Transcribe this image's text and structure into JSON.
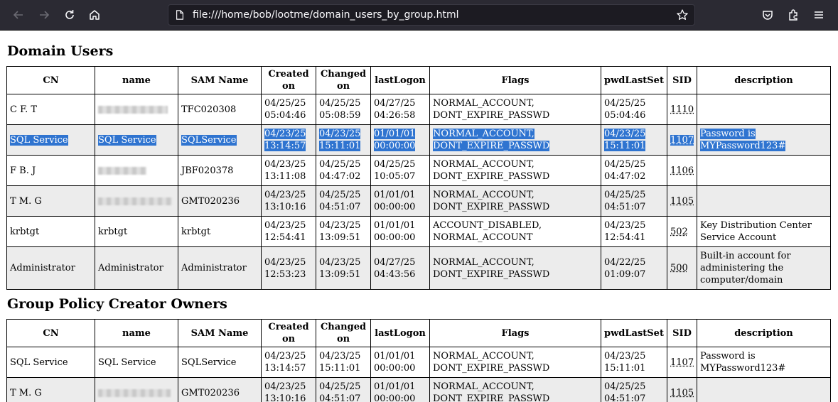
{
  "browser": {
    "url": "file:///home/bob/lootme/domain_users_by_group.html",
    "icons": [
      "back-icon",
      "forward-icon",
      "reload-icon",
      "home-icon",
      "page-icon",
      "bookmark-star-icon",
      "pocket-icon",
      "extensions-icon",
      "menu-icon"
    ]
  },
  "columns": [
    "CN",
    "name",
    "SAM Name",
    "Created on",
    "Changed on",
    "lastLogon",
    "Flags",
    "pwdLastSet",
    "SID",
    "description"
  ],
  "sections": [
    {
      "title": "Domain Users",
      "rows": [
        {
          "cn": "C F. T",
          "name": "",
          "sam": "TFC020308",
          "created": "04/25/25 05:04:46",
          "changed": "04/25/25 05:08:59",
          "lastlogon": "04/27/25 04:26:58",
          "flags": "NORMAL_ACCOUNT, DONT_EXPIRE_PASSWD",
          "pwdlastset": "04/25/25 05:04:46",
          "sid": "1110",
          "description": ""
        },
        {
          "cn": "SQL Service",
          "name": "SQL Service",
          "sam": "SQLService",
          "created": "04/23/25 13:14:57",
          "changed": "04/23/25 15:11:01",
          "lastlogon": "01/01/01 00:00:00",
          "flags": "NORMAL_ACCOUNT, DONT_EXPIRE_PASSWD",
          "pwdlastset": "04/23/25 15:11:01",
          "sid": "1107",
          "description": "Password is MYPassword123#"
        },
        {
          "cn": "F B. J",
          "name": "",
          "sam": "JBF020378",
          "created": "04/23/25 13:11:08",
          "changed": "04/25/25 04:47:02",
          "lastlogon": "04/25/25 10:05:07",
          "flags": "NORMAL_ACCOUNT, DONT_EXPIRE_PASSWD",
          "pwdlastset": "04/25/25 04:47:02",
          "sid": "1106",
          "description": ""
        },
        {
          "cn": "T M. G",
          "name": "",
          "sam": "GMT020236",
          "created": "04/23/25 13:10:16",
          "changed": "04/25/25 04:51:07",
          "lastlogon": "01/01/01 00:00:00",
          "flags": "NORMAL_ACCOUNT, DONT_EXPIRE_PASSWD",
          "pwdlastset": "04/25/25 04:51:07",
          "sid": "1105",
          "description": ""
        },
        {
          "cn": "krbtgt",
          "name": "krbtgt",
          "sam": "krbtgt",
          "created": "04/23/25 12:54:41",
          "changed": "04/23/25 13:09:51",
          "lastlogon": "01/01/01 00:00:00",
          "flags": "ACCOUNT_DISABLED, NORMAL_ACCOUNT",
          "pwdlastset": "04/23/25 12:54:41",
          "sid": "502",
          "description": "Key Distribution Center Service Account"
        },
        {
          "cn": "Administrator",
          "name": "Administrator",
          "sam": "Administrator",
          "created": "04/23/25 12:53:23",
          "changed": "04/23/25 13:09:51",
          "lastlogon": "04/27/25 04:43:56",
          "flags": "NORMAL_ACCOUNT, DONT_EXPIRE_PASSWD",
          "pwdlastset": "04/22/25 01:09:07",
          "sid": "500",
          "description": "Built-in account for administering the computer/domain"
        }
      ]
    },
    {
      "title": "Group Policy Creator Owners",
      "rows": [
        {
          "cn": "SQL Service",
          "name": "SQL Service",
          "sam": "SQLService",
          "created": "04/23/25 13:14:57",
          "changed": "04/23/25 15:11:01",
          "lastlogon": "01/01/01 00:00:00",
          "flags": "NORMAL_ACCOUNT, DONT_EXPIRE_PASSWD",
          "pwdlastset": "04/23/25 15:11:01",
          "sid": "1107",
          "description": "Password is MYPassword123#"
        },
        {
          "cn": "T M. G",
          "name": "",
          "sam": "GMT020236",
          "created": "04/23/25 13:10:16",
          "changed": "04/25/25 04:51:07",
          "lastlogon": "01/01/01 00:00:00",
          "flags": "NORMAL_ACCOUNT, DONT_EXPIRE_PASSWD",
          "pwdlastset": "04/25/25 04:51:07",
          "sid": "1105",
          "description": ""
        }
      ]
    }
  ]
}
